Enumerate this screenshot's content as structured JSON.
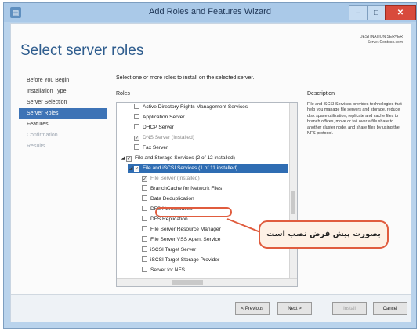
{
  "window": {
    "title": "Add Roles and Features Wizard",
    "icon": "server-manager-icon"
  },
  "page": {
    "heading": "Select server roles",
    "destination_label": "DESTINATION SERVER",
    "destination_value": "Server.Contoso.com"
  },
  "nav": {
    "items": [
      {
        "label": "Before You Begin",
        "state": "normal"
      },
      {
        "label": "Installation Type",
        "state": "normal"
      },
      {
        "label": "Server Selection",
        "state": "normal"
      },
      {
        "label": "Server Roles",
        "state": "active"
      },
      {
        "label": "Features",
        "state": "normal"
      },
      {
        "label": "Confirmation",
        "state": "disabled"
      },
      {
        "label": "Results",
        "state": "disabled"
      }
    ]
  },
  "roles": {
    "instruction": "Select one or more roles to install on the selected server.",
    "label": "Roles",
    "items": [
      {
        "label": "Active Directory Rights Management Services",
        "indent": 1,
        "checked": false,
        "expander": ""
      },
      {
        "label": "Application Server",
        "indent": 1,
        "checked": false,
        "expander": ""
      },
      {
        "label": "DHCP Server",
        "indent": 1,
        "checked": false,
        "expander": ""
      },
      {
        "label": "DNS Server (Installed)",
        "indent": 1,
        "checked": true,
        "grey": true,
        "expander": ""
      },
      {
        "label": "Fax Server",
        "indent": 1,
        "checked": false,
        "expander": ""
      },
      {
        "label": "File and Storage Services (2 of 12 installed)",
        "indent": 0,
        "checked": true,
        "expander": "◢"
      },
      {
        "label": "File and iSCSI Services (1 of 11 installed)",
        "indent": 1,
        "checked": true,
        "expander": "◢",
        "highlighted": true
      },
      {
        "label": "File Server (Installed)",
        "indent": 2,
        "checked": true,
        "grey": true,
        "expander": ""
      },
      {
        "label": "BranchCache for Network Files",
        "indent": 2,
        "checked": false,
        "expander": ""
      },
      {
        "label": "Data Deduplication",
        "indent": 2,
        "checked": false,
        "expander": ""
      },
      {
        "label": "DFS Namespaces",
        "indent": 2,
        "checked": false,
        "expander": ""
      },
      {
        "label": "DFS Replication",
        "indent": 2,
        "checked": false,
        "expander": ""
      },
      {
        "label": "File Server Resource Manager",
        "indent": 2,
        "checked": false,
        "expander": ""
      },
      {
        "label": "File Server VSS Agent Service",
        "indent": 2,
        "checked": false,
        "expander": ""
      },
      {
        "label": "iSCSI Target Server",
        "indent": 2,
        "checked": false,
        "expander": ""
      },
      {
        "label": "iSCSI Target Storage Provider",
        "indent": 2,
        "checked": false,
        "expander": ""
      },
      {
        "label": "Server for NFS",
        "indent": 2,
        "checked": false,
        "expander": ""
      }
    ]
  },
  "callout": {
    "text": "بصورت پیش فرض نصب است"
  },
  "description": {
    "title": "Description",
    "text": "File and iSCSI Services provides technologies that help you manage file servers and storage, reduce disk space utilization, replicate and cache files to branch offices, move or fail over a file share to another cluster node, and share files by using the NFS protocol."
  },
  "buttons": {
    "previous": "< Previous",
    "next": "Next >",
    "install": "Install",
    "cancel": "Cancel"
  },
  "colors": {
    "accent": "#3d73b6",
    "heading": "#2f5d8e",
    "callout_border": "#e05c3e",
    "close_button": "#d84a3c"
  }
}
